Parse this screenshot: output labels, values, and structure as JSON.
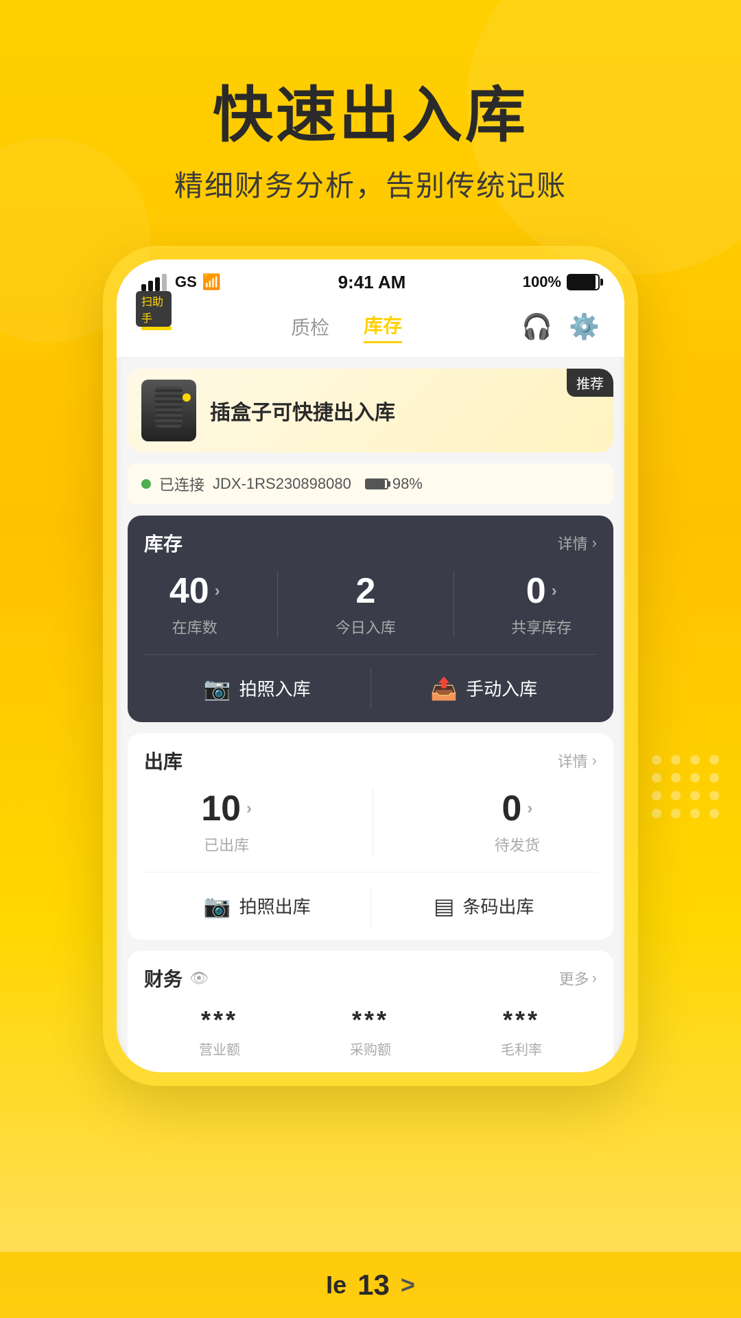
{
  "page": {
    "background_color": "#FFD000",
    "main_title": "快速出入库",
    "sub_title": "精细财务分析，告别传统记账"
  },
  "status_bar": {
    "carrier": "GS",
    "time": "9:41 AM",
    "battery_pct": "100%"
  },
  "nav": {
    "logo_badge": "扫助手",
    "tab_quality": "质检",
    "tab_inventory": "库存",
    "support_icon": "headset",
    "settings_icon": "gear"
  },
  "product_banner": {
    "badge": "推荐",
    "title": "插盒子可快捷出入库"
  },
  "connection": {
    "label": "已连接",
    "device_id": "JDX-1RS230898080",
    "battery": "98%"
  },
  "inventory": {
    "title": "库存",
    "detail_label": "详情",
    "stats": [
      {
        "value": "40",
        "label": "在库数",
        "has_arrow": true
      },
      {
        "value": "2",
        "label": "今日入库",
        "has_arrow": false
      },
      {
        "value": "0",
        "label": "共享库存",
        "has_arrow": true
      }
    ],
    "btn_photo": "拍照入库",
    "btn_manual": "手动入库"
  },
  "outbound": {
    "title": "出库",
    "detail_label": "详情",
    "stats": [
      {
        "value": "10",
        "label": "已出库",
        "has_arrow": true
      },
      {
        "value": "0",
        "label": "待发货",
        "has_arrow": true
      }
    ],
    "btn_photo": "拍照出库",
    "btn_barcode": "条码出库"
  },
  "finance": {
    "title": "财务",
    "eye_icon": "eye",
    "more_label": "更多",
    "stats": [
      {
        "value": "***",
        "label": "营业额"
      },
      {
        "value": "***",
        "label": "采购额"
      },
      {
        "value": "***",
        "label": "毛利率"
      }
    ]
  },
  "bottom": {
    "page_label": "Ie",
    "page_num": "13",
    "chevron": ">"
  }
}
